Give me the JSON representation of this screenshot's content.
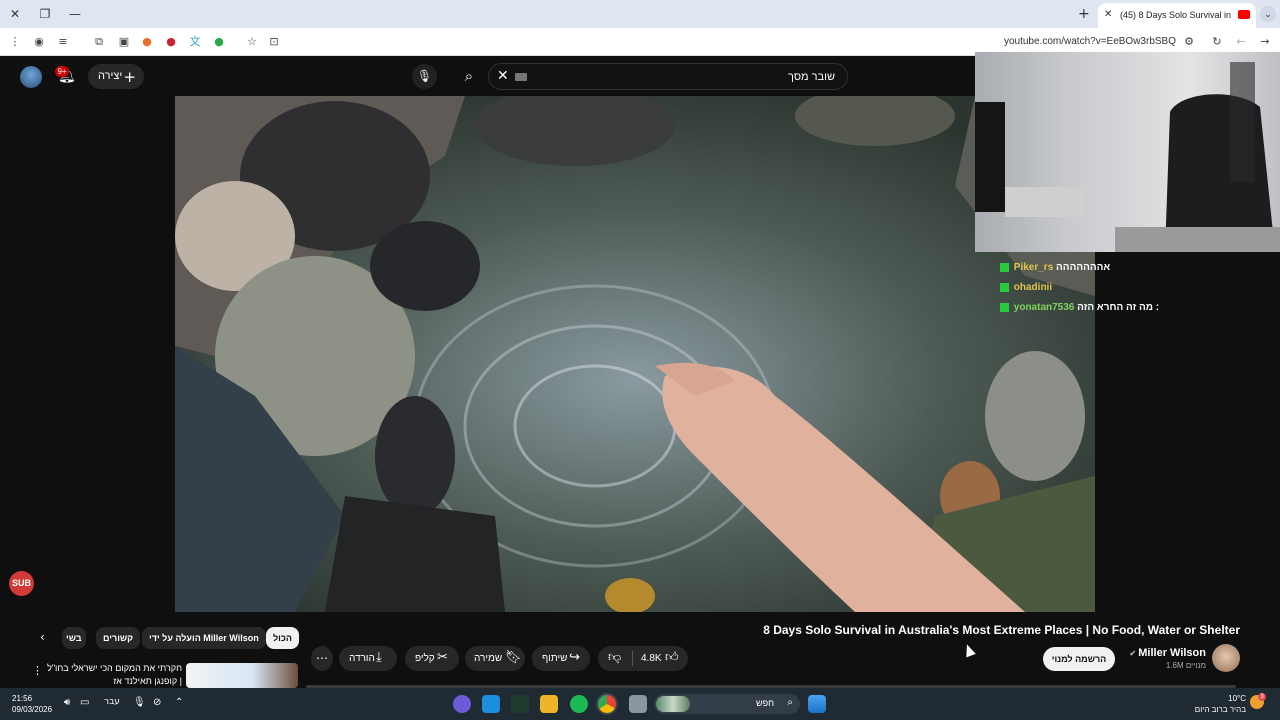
{
  "browser": {
    "tab_title": "(45) 8 Days Solo Survival in",
    "url": "youtube.com/watch?v=EeBOw3rbSBQ"
  },
  "header": {
    "create_label": "יצירה",
    "notifications_badge": "9+",
    "search_query": "שובר מסך"
  },
  "stream_overlay": {
    "chat": [
      {
        "user": "Piker_rs",
        "message": "אההההההה"
      },
      {
        "user": "ohadinii",
        "message": ""
      },
      {
        "user": "yonatan7536",
        "message": "מה זה החרא הזה :"
      }
    ],
    "sub_badge": "SUB"
  },
  "video": {
    "title": "8 Days Solo Survival in Australia's Most Extreme Places | No Food, Water or Shelter",
    "channel_name": "Miller Wilson",
    "subscribers": "1.6M מנויים",
    "subscribe_label": "הרשמה למנוי",
    "likes": "4.8K",
    "share_label": "שיתוף",
    "save_label": "שמירה",
    "clip_label": "קליפ",
    "download_label": "הורדה"
  },
  "recommendations": {
    "chips": [
      "הכול",
      "הועלה על ידי Miller Wilson",
      "קשורים",
      "בשי"
    ],
    "first_item_title": "חקרתי את המקום הכי ישראלי בחו\"ל | קופנגן תאילנד אז"
  },
  "taskbar": {
    "time": "21:56",
    "date": "09/03/2026",
    "language": "עבר",
    "search_label": "חפש",
    "weather_temp": "10°C",
    "weather_desc": "בהיר ברוב היום",
    "weather_badge": "3"
  }
}
